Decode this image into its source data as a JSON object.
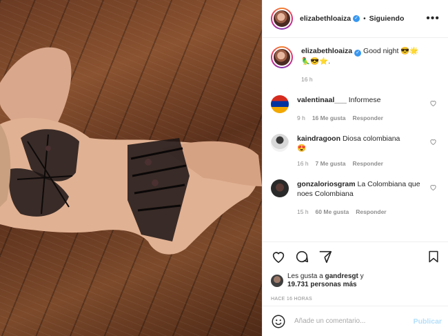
{
  "post": {
    "author": "elizabethloaiza",
    "follow_status": "Siguiendo",
    "dot": "•",
    "more_label": "•••",
    "caption_text": "Good night",
    "caption_time": "16 h"
  },
  "comments": [
    {
      "user": "valentinaal___",
      "text": "Informese",
      "time": "9 h",
      "likes": "16 Me gusta",
      "reply": "Responder"
    },
    {
      "user": "kaindragoon",
      "text": "Diosa colombiana",
      "time": "16 h",
      "likes": "7 Me gusta",
      "reply": "Responder"
    },
    {
      "user": "gonzaloriosgram",
      "text": "La Colombiana que noes Colombiana",
      "time": "15 h",
      "likes": "60 Me gusta",
      "reply": "Responder"
    }
  ],
  "likes": {
    "prefix": "Les gusta a",
    "user": "gandresgt",
    "joiner": "y",
    "count": "19.731 personas más"
  },
  "posted_ago": "HACE 16 HORAS",
  "add_comment": {
    "placeholder": "Añade un comentario...",
    "publish_label": "Publicar"
  },
  "icons": {
    "verified": "verified-badge",
    "like": "heart-icon",
    "comment": "comment-icon",
    "share": "share-icon",
    "save": "bookmark-icon",
    "emoji": "emoji-icon"
  },
  "colors": {
    "verified": "#3897f0",
    "publish_disabled": "#b2dffc",
    "meta_gray": "#8e8e8e"
  }
}
